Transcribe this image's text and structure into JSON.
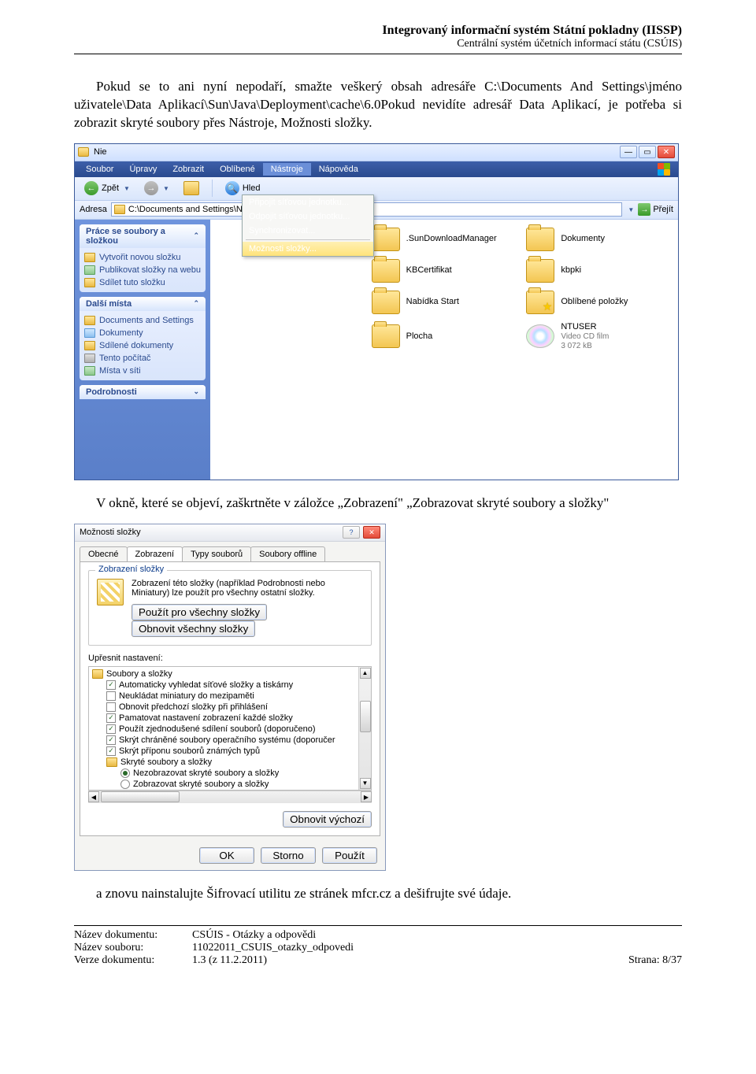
{
  "header": {
    "title1": "Integrovaný informační systém Státní pokladny (IISSP)",
    "title2": "Centrální systém účetních informací státu (CSÚIS)"
  },
  "para1": "Pokud se to ani nyní nepodaří, smažte veškerý obsah adresáře C:\\Documents And Settings\\jméno uživatele\\Data Aplikací\\Sun\\Java\\Deployment\\cache\\6.0Pokud nevidíte adresář Data Aplikací, je potřeba si zobrazit skryté soubory přes Nástroje, Možnosti složky.",
  "explorer": {
    "title": "Nie",
    "menu": {
      "items": [
        "Soubor",
        "Úpravy",
        "Zobrazit",
        "Oblíbené",
        "Nástroje",
        "Nápověda"
      ],
      "openIndex": 4
    },
    "toolbar": {
      "back": "Zpět",
      "search": "Hled"
    },
    "addrbar": {
      "label": "Adresa",
      "path": "C:\\Documents and Settings\\Nie",
      "go": "Přejít"
    },
    "dropdown": {
      "items": [
        {
          "label": "Připojit síťovou jednotku...",
          "hl": false
        },
        {
          "label": "Odpojit síťovou jednotku...",
          "hl": false
        },
        {
          "label": "Synchronizovat...",
          "hl": false
        },
        {
          "sep": true
        },
        {
          "label": "Možnosti složky...",
          "hl": true
        }
      ]
    },
    "sidebar": {
      "panel1": {
        "title": "Práce se soubory a složkou",
        "items": [
          "Vytvořit novou složku",
          "Publikovat složky na webu",
          "Sdílet tuto složku"
        ]
      },
      "panel2": {
        "title": "Další místa",
        "items": [
          "Documents and Settings",
          "Dokumenty",
          "Sdílené dokumenty",
          "Tento počítač",
          "Místa v síti"
        ]
      },
      "panel3": {
        "title": "Podrobnosti"
      }
    },
    "files": [
      {
        "name": ".SunDownloadManager",
        "type": "folder"
      },
      {
        "name": "Dokumenty",
        "type": "folder"
      },
      {
        "name": "KBCertifikat",
        "type": "folder"
      },
      {
        "name": "kbpki",
        "type": "folder"
      },
      {
        "name": "Nabídka Start",
        "type": "folder"
      },
      {
        "name": "Oblíbené položky",
        "type": "fav"
      },
      {
        "name": "Plocha",
        "type": "folder"
      },
      {
        "name": "NTUSER",
        "type": "cd",
        "sub1": "Video CD film",
        "sub2": "3 072 kB"
      }
    ]
  },
  "para2": "V okně, které se objeví, zaškrtněte v záložce „Zobrazení\" „Zobrazovat skryté soubory a složky\"",
  "dialog": {
    "title": "Možnosti složky",
    "tabs": [
      "Obecné",
      "Zobrazení",
      "Typy souborů",
      "Soubory offline"
    ],
    "activeTab": 1,
    "group1": {
      "label": "Zobrazení složky",
      "text": "Zobrazení této složky (například Podrobnosti nebo Miniatury) lze použít pro všechny ostatní složky.",
      "btn1": "Použít pro všechny složky",
      "btn2": "Obnovit všechny složky"
    },
    "advLabel": "Upřesnit nastavení:",
    "tree": [
      {
        "type": "folder",
        "label": "Soubory a složky"
      },
      {
        "type": "check",
        "checked": true,
        "label": "Automaticky vyhledat síťové složky a tiskárny",
        "lvl": 1
      },
      {
        "type": "check",
        "checked": false,
        "label": "Neukládat miniatury do mezipaměti",
        "lvl": 1
      },
      {
        "type": "check",
        "checked": false,
        "label": "Obnovit předchozí složky při přihlášení",
        "lvl": 1
      },
      {
        "type": "check",
        "checked": true,
        "label": "Pamatovat nastavení zobrazení každé složky",
        "lvl": 1
      },
      {
        "type": "check",
        "checked": true,
        "label": "Použít zjednodušené sdílení souborů (doporučeno)",
        "lvl": 1
      },
      {
        "type": "check",
        "checked": true,
        "label": "Skrýt chráněné soubory operačního systému (doporučer",
        "lvl": 1
      },
      {
        "type": "check",
        "checked": true,
        "label": "Skrýt příponu souborů známých typů",
        "lvl": 1
      },
      {
        "type": "folder",
        "label": "Skryté soubory a složky",
        "lvl": 1
      },
      {
        "type": "radio",
        "checked": true,
        "label": "Nezobrazovat skryté soubory a složky",
        "lvl": 2
      },
      {
        "type": "radio",
        "checked": false,
        "label": "Zobrazovat skryté soubory a složky",
        "lvl": 2
      }
    ],
    "restore": "Obnovit výchozí",
    "ok": "OK",
    "cancel": "Storno",
    "apply": "Použít"
  },
  "para3": "a znovu nainstalujte Šifrovací utilitu ze stránek mfcr.cz a dešifrujte své údaje.",
  "footer": {
    "l1label": "Název dokumentu:",
    "l1val": "CSÚIS - Otázky a odpovědi",
    "l2label": "Název souboru:",
    "l2val": "11022011_CSUIS_otazky_odpovedi",
    "l3label": "Verze dokumentu:",
    "l3val": "1.3 (z 11.2.2011)",
    "page": "Strana: 8/37"
  }
}
